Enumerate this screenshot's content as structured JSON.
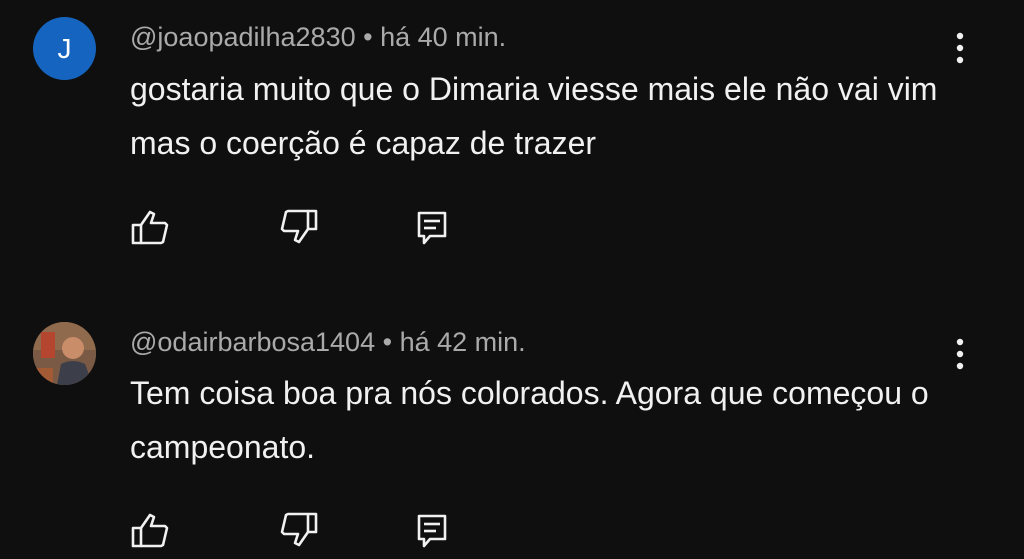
{
  "comments": [
    {
      "avatar_letter": "J",
      "avatar_color": "#1565c0",
      "handle": "@joaopadilha2830",
      "separator": "•",
      "time": "há 40 min.",
      "text": "gostaria muito que o Dimaria viesse mais ele não vai vim mas o coerção é capaz de trazer",
      "actions": [
        "thumbs-up-icon",
        "thumbs-down-icon",
        "reply-icon"
      ]
    },
    {
      "avatar_letter": "",
      "avatar_type": "photo",
      "handle": "@odairbarbosa1404",
      "separator": "•",
      "time": "há 42 min.",
      "text": "Tem coisa boa pra nós colorados. Agora que começou o campeonato.",
      "actions": [
        "thumbs-up-icon",
        "thumbs-down-icon",
        "reply-icon"
      ]
    }
  ],
  "colors": {
    "background": "#0f0f0f",
    "text": "#f1f1f1",
    "meta": "#aaaaaa"
  }
}
